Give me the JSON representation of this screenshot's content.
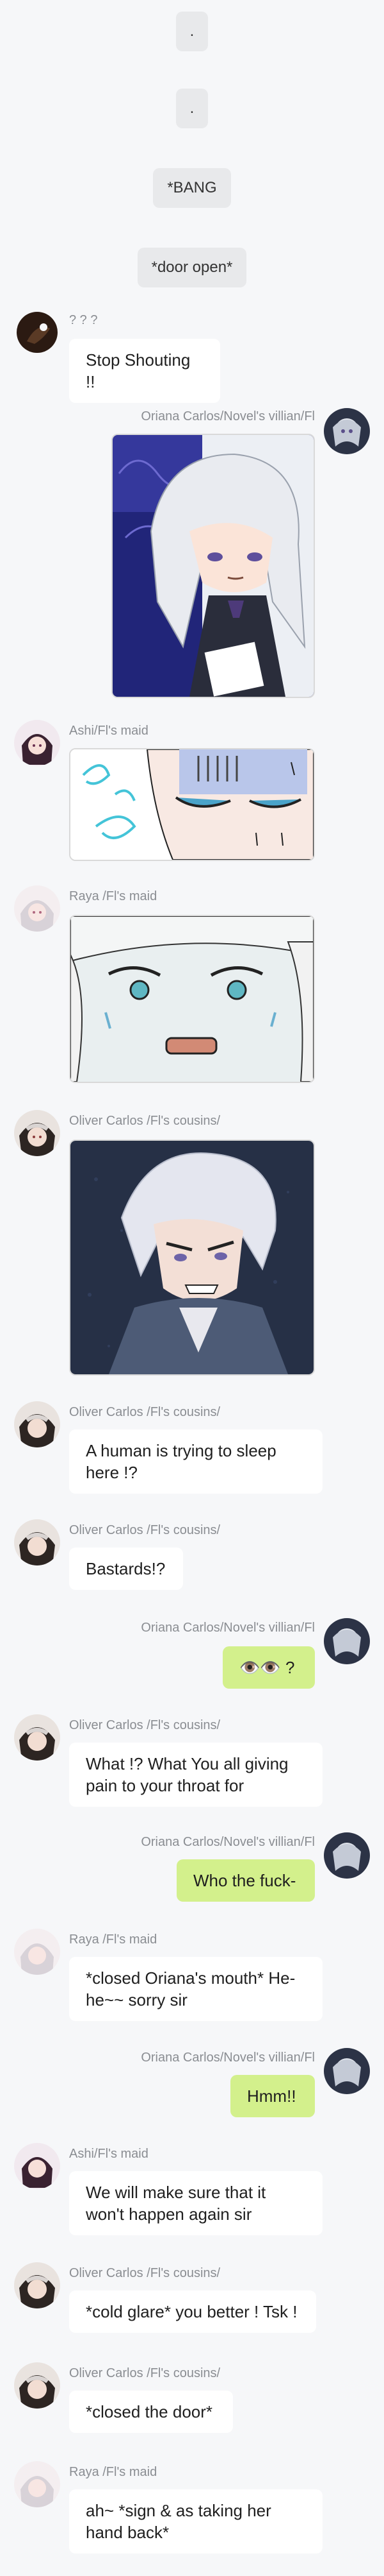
{
  "narration": [
    ".",
    ".",
    "*BANG",
    "*door open*"
  ],
  "speakers": {
    "unknown": "? ? ?",
    "oriana": "Oriana Carlos/Novel's villian/Fl",
    "ashi": "Ashi/Fl's maid",
    "raya": "Raya /Fl's maid",
    "oliver": "Oliver Carlos /Fl's cousins/"
  },
  "messages": {
    "m1": "Stop Shouting !!",
    "m2": "A human is trying to sleep here !?",
    "m3": "Bastards!?",
    "m4": "👁️👁️ ?",
    "m5": "What !? What You all giving pain to your throat for",
    "m6": "Who the fuck-",
    "m7": "*closed Oriana's mouth* He-he~~ sorry sir",
    "m8": "Hmm!!",
    "m9": "We will make sure that it won't happen again sir",
    "m10": "*cold glare* you better ! Tsk !",
    "m11": "*closed the door*",
    "m12": "ah~ *sign & as taking her hand back*"
  },
  "colors": {
    "background": "#f6f7f9",
    "bubble_left": "#ffffff",
    "bubble_right": "#d3f08c",
    "narration": "#e8e9eb",
    "name_text": "#8a8d92"
  }
}
